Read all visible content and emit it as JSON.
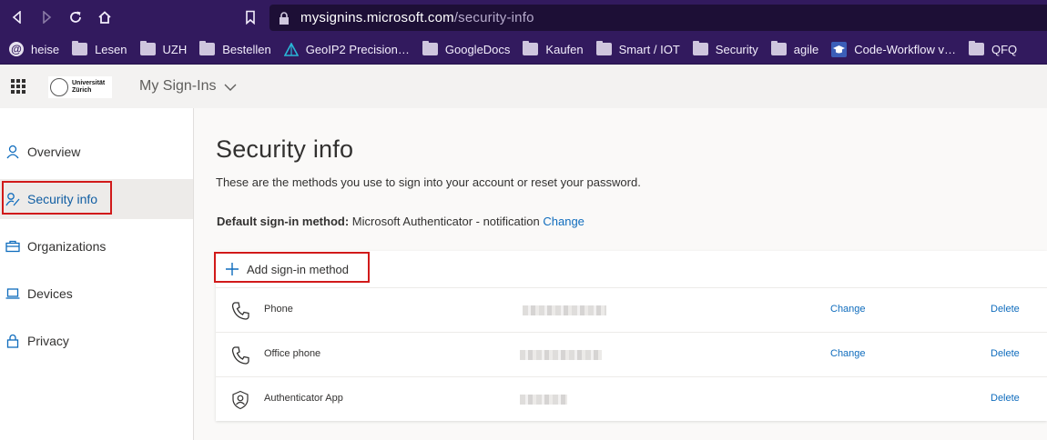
{
  "browser": {
    "url_host": "mysignins.microsoft.com",
    "url_path": "/security-info",
    "bookmarks": [
      {
        "label": "heise",
        "icon": "heise-icon"
      },
      {
        "label": "Lesen",
        "icon": "folder-icon"
      },
      {
        "label": "UZH",
        "icon": "folder-icon"
      },
      {
        "label": "Bestellen",
        "icon": "folder-icon"
      },
      {
        "label": "GeoIP2 Precision…",
        "icon": "geoip-icon"
      },
      {
        "label": "GoogleDocs",
        "icon": "folder-icon"
      },
      {
        "label": "Kaufen",
        "icon": "folder-icon"
      },
      {
        "label": "Smart / IOT",
        "icon": "folder-icon"
      },
      {
        "label": "Security",
        "icon": "folder-icon"
      },
      {
        "label": "agile",
        "icon": "folder-icon"
      },
      {
        "label": "Code-Workflow v…",
        "icon": "graduation-cap-icon"
      },
      {
        "label": "QFQ",
        "icon": "folder-icon"
      }
    ]
  },
  "app": {
    "logo_line1": "Universität",
    "logo_line2": "Zürich",
    "title": "My Sign-Ins"
  },
  "sidebar": {
    "items": [
      {
        "label": "Overview",
        "icon": "person-icon"
      },
      {
        "label": "Security info",
        "icon": "person-key-icon",
        "active": true
      },
      {
        "label": "Organizations",
        "icon": "briefcase-icon"
      },
      {
        "label": "Devices",
        "icon": "laptop-icon"
      },
      {
        "label": "Privacy",
        "icon": "lock-icon"
      }
    ]
  },
  "main": {
    "title": "Security info",
    "description": "These are the methods you use to sign into your account or reset your password.",
    "default_label": "Default sign-in method:",
    "default_value": "Microsoft Authenticator - notification",
    "default_change": "Change",
    "add_method": "Add sign-in method",
    "methods": [
      {
        "name": "Phone",
        "icon": "phone-icon",
        "change": "Change",
        "delete": "Delete"
      },
      {
        "name": "Office phone",
        "icon": "phone-icon",
        "change": "Change",
        "delete": "Delete"
      },
      {
        "name": "Authenticator App",
        "icon": "authenticator-icon",
        "change": "",
        "delete": "Delete"
      }
    ]
  },
  "colors": {
    "chrome": "#321a5e",
    "accent": "#0f6cbd",
    "highlight": "#d11a1a"
  }
}
